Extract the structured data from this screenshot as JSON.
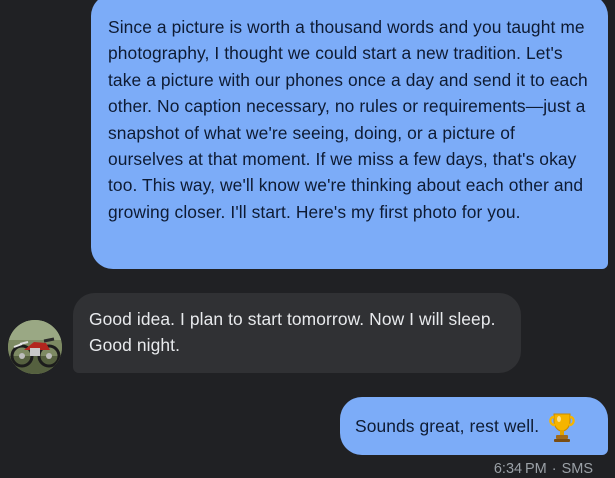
{
  "messages": [
    {
      "direction": "outgoing",
      "text": "Since a picture is worth a thousand words and you taught me photography, I thought we could start a new tradition. Let's take a picture with our phones once a day and send it to each other. No caption necessary, no rules or requirements—just a snapshot of what we're seeing, doing, or a picture of ourselves at that moment. If we miss a few days, that's okay too. This way, we'll know we're thinking about each other and growing closer. I'll start. Here's my first photo for you."
    },
    {
      "direction": "incoming",
      "text": "Good idea.  I plan to start tomorrow.  Now I will sleep.  Good night.",
      "avatar": "contact-avatar-motorcycle-photo"
    },
    {
      "direction": "outgoing",
      "text": "Sounds great, rest well.",
      "emoji": "trophy-icon"
    }
  ],
  "footer": {
    "time": "6:34 PM",
    "separator": "·",
    "channel": "SMS"
  },
  "colors": {
    "background": "#202124",
    "outgoing_bubble": "#7cacf8",
    "incoming_bubble": "#303134",
    "meta_text": "#9aa0a6"
  }
}
